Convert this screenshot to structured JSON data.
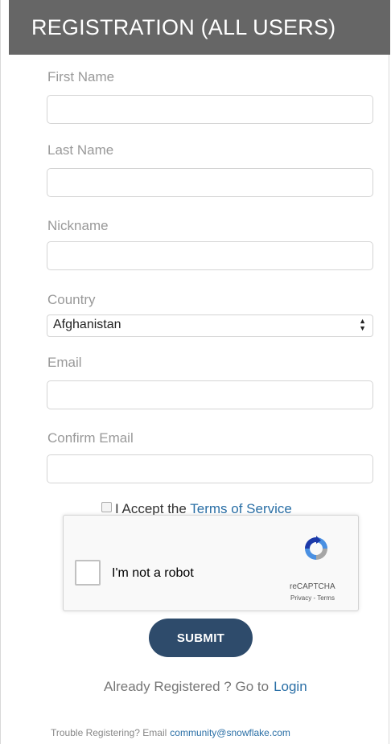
{
  "header": {
    "title": "REGISTRATION (ALL USERS)"
  },
  "form": {
    "first_name": {
      "label": "First Name",
      "value": ""
    },
    "last_name": {
      "label": "Last Name",
      "value": ""
    },
    "nickname": {
      "label": "Nickname",
      "value": ""
    },
    "country": {
      "label": "Country",
      "selected": "Afghanistan"
    },
    "email": {
      "label": "Email",
      "value": ""
    },
    "confirm_email": {
      "label": "Confirm Email",
      "value": ""
    }
  },
  "terms": {
    "prefix": "I Accept the",
    "link": "Terms of Service",
    "checked": false
  },
  "recaptcha": {
    "label": "I'm not a robot",
    "brand": "reCAPTCHA",
    "links": "Privacy - Terms"
  },
  "submit_label": "SUBMIT",
  "login": {
    "prefix": "Already Registered ? Go to",
    "link": "Login"
  },
  "footer": {
    "prefix": "Trouble Registering? Email",
    "email": "community@snowflake.com"
  },
  "colors": {
    "header_bg": "#666666",
    "button_bg": "#2e4b6b",
    "link": "#2a6fa6"
  }
}
